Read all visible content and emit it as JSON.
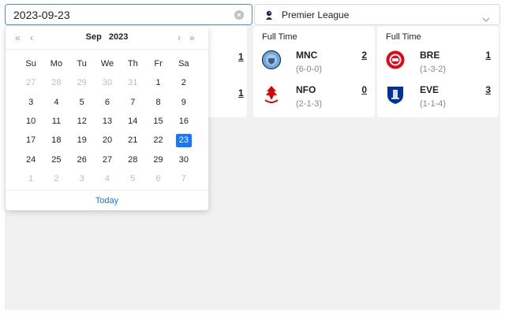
{
  "date_input": {
    "value": "2023-09-23"
  },
  "league": {
    "name": "Premier League"
  },
  "partial_card": {
    "score_top": "1",
    "score_bottom": "1"
  },
  "matches": [
    {
      "status": "Full Time",
      "home": {
        "abbr": "MNC",
        "record": "(6-0-0)",
        "score": "2",
        "color": "#6cabdd"
      },
      "away": {
        "abbr": "NFO",
        "record": "(2-1-3)",
        "score": "0",
        "color": "#dd0000"
      }
    },
    {
      "status": "Full Time",
      "home": {
        "abbr": "BRE",
        "record": "(1-3-2)",
        "score": "1",
        "color": "#e30613"
      },
      "away": {
        "abbr": "EVE",
        "record": "(1-1-4)",
        "score": "3",
        "color": "#003399"
      }
    }
  ],
  "calendar": {
    "month": "Sep",
    "year": "2023",
    "nav": {
      "prev_year": "«",
      "prev_month": "‹",
      "next_month": "›",
      "next_year": "»"
    },
    "weekdays": [
      "Su",
      "Mo",
      "Tu",
      "We",
      "Th",
      "Fr",
      "Sa"
    ],
    "weeks": [
      [
        {
          "d": "27",
          "dim": true
        },
        {
          "d": "28",
          "dim": true
        },
        {
          "d": "29",
          "dim": true
        },
        {
          "d": "30",
          "dim": true
        },
        {
          "d": "31",
          "dim": true
        },
        {
          "d": "1"
        },
        {
          "d": "2"
        }
      ],
      [
        {
          "d": "3"
        },
        {
          "d": "4"
        },
        {
          "d": "5"
        },
        {
          "d": "6"
        },
        {
          "d": "7"
        },
        {
          "d": "8"
        },
        {
          "d": "9"
        }
      ],
      [
        {
          "d": "10"
        },
        {
          "d": "11"
        },
        {
          "d": "12"
        },
        {
          "d": "13"
        },
        {
          "d": "14"
        },
        {
          "d": "15"
        },
        {
          "d": "16"
        }
      ],
      [
        {
          "d": "17"
        },
        {
          "d": "18"
        },
        {
          "d": "19"
        },
        {
          "d": "20"
        },
        {
          "d": "21"
        },
        {
          "d": "22"
        },
        {
          "d": "23",
          "selected": true
        }
      ],
      [
        {
          "d": "24"
        },
        {
          "d": "25"
        },
        {
          "d": "26"
        },
        {
          "d": "27"
        },
        {
          "d": "28"
        },
        {
          "d": "29"
        },
        {
          "d": "30"
        }
      ],
      [
        {
          "d": "1",
          "dim": true
        },
        {
          "d": "2",
          "dim": true
        },
        {
          "d": "3",
          "dim": true
        },
        {
          "d": "4",
          "dim": true
        },
        {
          "d": "5",
          "dim": true
        },
        {
          "d": "6",
          "dim": true
        },
        {
          "d": "7",
          "dim": true
        }
      ]
    ],
    "today_label": "Today"
  },
  "colors": {
    "accent": "#1677ff",
    "input_border": "#4a90e2",
    "dim_text": "#bdbdbd",
    "background": "#f1f1f1"
  }
}
